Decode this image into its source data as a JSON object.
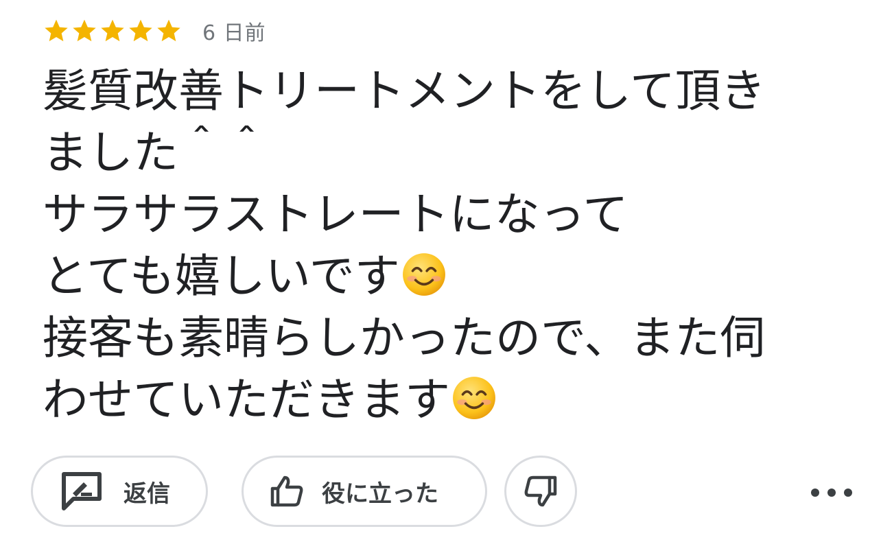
{
  "review": {
    "rating": 5,
    "rating_max": 5,
    "star_color": "#f4b400",
    "date": "6 日前",
    "lines": [
      "髪質改善トリートメントをして頂き",
      "ました＾＾",
      "サラサラストレートになって",
      "とても嬉しいです",
      "接客も素晴らしかったので、また伺",
      "わせていただきます"
    ],
    "line_emoji": [
      "",
      "",
      "",
      "smiling-face-emoji",
      "",
      "smiling-face-emoji"
    ]
  },
  "actions": {
    "reply": {
      "label": "返信",
      "icon": "reply-icon"
    },
    "helpful": {
      "label": "役に立った",
      "icon": "thumbs-up-icon"
    },
    "not_helpful": {
      "icon": "thumbs-down-icon"
    },
    "more": {
      "icon": "more-horizontal-icon"
    }
  },
  "colors": {
    "text": "#202124",
    "secondary_text": "#70757a",
    "pill_border": "#dadce0",
    "icon": "#3c4043"
  }
}
